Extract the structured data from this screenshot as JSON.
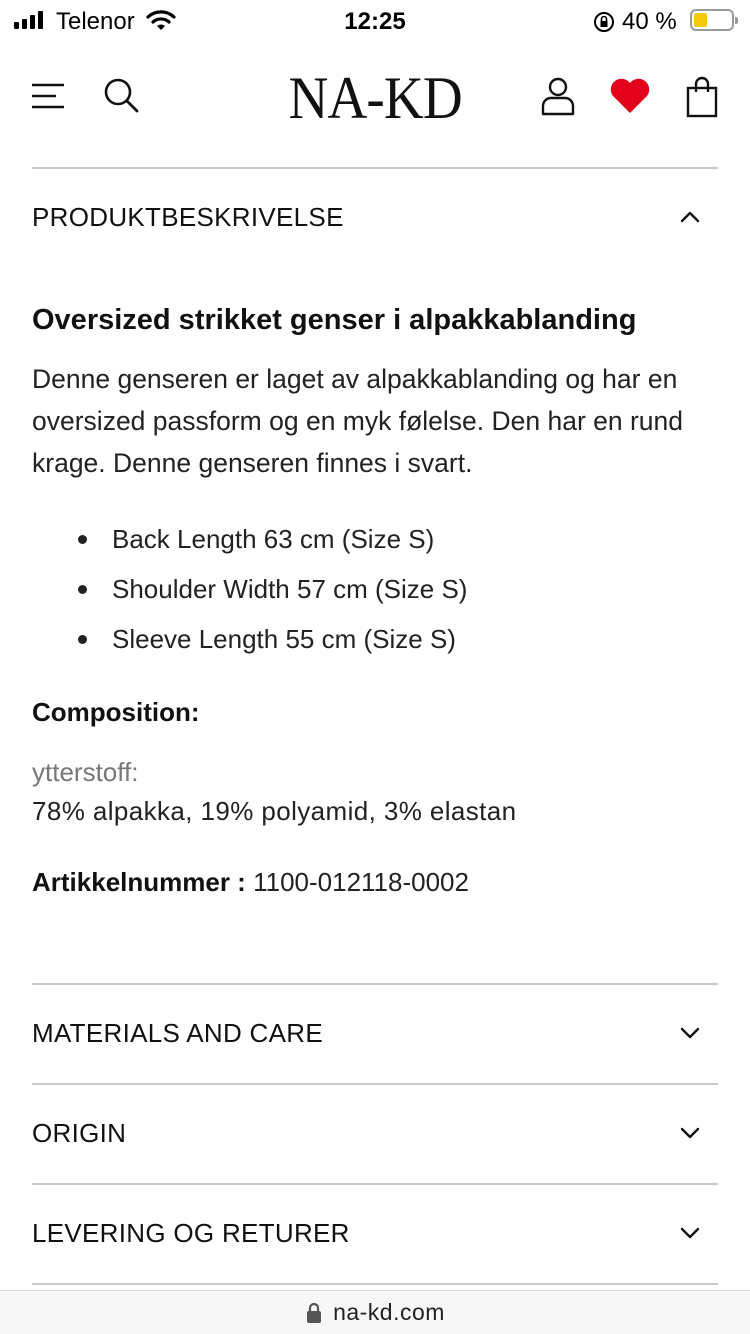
{
  "status_bar": {
    "carrier": "Telenor",
    "time": "12:25",
    "battery_percent": "40 %",
    "battery_level": 0.4
  },
  "header": {
    "logo": "NA-KD",
    "icons": [
      "menu-icon",
      "search-icon",
      "account-icon",
      "heart-icon",
      "bag-icon"
    ],
    "heart_color": "#e3001b"
  },
  "product_description": {
    "section_title": "PRODUKTBESKRIVELSE",
    "expanded": true,
    "title": "Oversized strikket genser i alpakkablanding",
    "text": "Denne genseren er laget av alpakkablanding og har en oversized passform og en myk følelse. Den har en rund krage. Denne genseren finnes i svart.",
    "bullets": [
      "Back Length 63 cm (Size S)",
      "Shoulder Width 57 cm (Size S)",
      "Sleeve Length 55 cm (Size S)"
    ],
    "composition_label": "Composition:",
    "composition_part": "ytterstoff:",
    "composition_value": "78% alpakka, 19% polyamid, 3% elastan",
    "article_label": "Artikkelnummer :",
    "article_number": "1100-012118-0002"
  },
  "sections": [
    {
      "title": "MATERIALS AND CARE",
      "expanded": false
    },
    {
      "title": "ORIGIN",
      "expanded": false
    },
    {
      "title": "LEVERING OG RETURER",
      "expanded": false
    }
  ],
  "url_bar": {
    "url": "na-kd.com",
    "icon": "lock-icon"
  }
}
